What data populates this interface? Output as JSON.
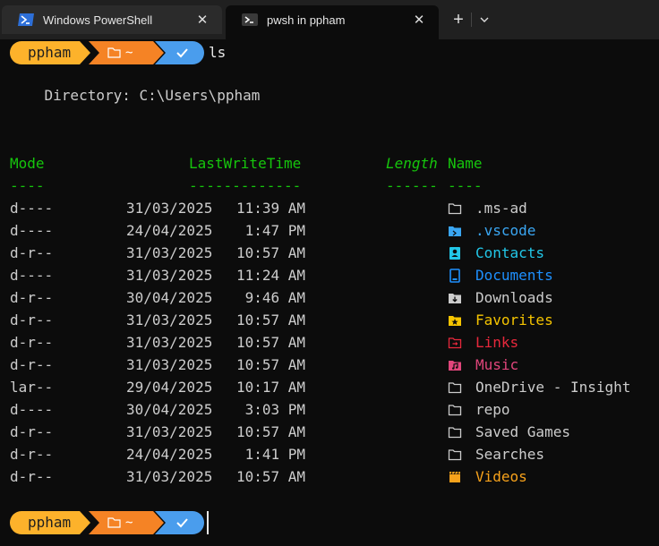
{
  "tabs": [
    {
      "label": "Windows PowerShell",
      "close": "✕"
    },
    {
      "label": "pwsh in ppham",
      "close": "✕"
    }
  ],
  "tabbar": {
    "new_tab": "+",
    "dropdown": "⌄"
  },
  "prompt": {
    "user": "ppham",
    "folder_symbol": "~",
    "command": "ls",
    "colors": {
      "user": "#fdb22b",
      "folder": "#f58325",
      "status": "#4a9ded"
    }
  },
  "directory_line": "    Directory: C:\\Users\\ppham",
  "headers": {
    "mode": "Mode",
    "lastwritetime": "LastWriteTime",
    "length": "Length",
    "name": "Name"
  },
  "underlines": {
    "mode": "----",
    "lastwritetime": "-------------",
    "length": "------",
    "name": "----"
  },
  "rows": [
    {
      "mode": "d----",
      "date": "31/03/2025",
      "time": "11:39 AM",
      "name": ".ms-ad",
      "icon": "folder-icon",
      "color": "#cccccc"
    },
    {
      "mode": "d----",
      "date": "24/04/2025",
      "time": "1:47 PM",
      "name": ".vscode",
      "icon": "vscode-folder-icon",
      "color": "#3aa6f2"
    },
    {
      "mode": "d-r--",
      "date": "31/03/2025",
      "time": "10:57 AM",
      "name": "Contacts",
      "icon": "contacts-icon",
      "color": "#22c7e8"
    },
    {
      "mode": "d----",
      "date": "31/03/2025",
      "time": "11:24 AM",
      "name": "Documents",
      "icon": "documents-icon",
      "color": "#1e90ff"
    },
    {
      "mode": "d-r--",
      "date": "30/04/2025",
      "time": "9:46 AM",
      "name": "Downloads",
      "icon": "downloads-icon",
      "color": "#cccccc"
    },
    {
      "mode": "d-r--",
      "date": "31/03/2025",
      "time": "10:57 AM",
      "name": "Favorites",
      "icon": "favorites-icon",
      "color": "#f5c400"
    },
    {
      "mode": "d-r--",
      "date": "31/03/2025",
      "time": "10:57 AM",
      "name": "Links",
      "icon": "links-icon",
      "color": "#e8283c"
    },
    {
      "mode": "d-r--",
      "date": "31/03/2025",
      "time": "10:57 AM",
      "name": "Music",
      "icon": "music-icon",
      "color": "#e0457b"
    },
    {
      "mode": "lar--",
      "date": "29/04/2025",
      "time": "10:17 AM",
      "name": "OneDrive - Insight",
      "icon": "folder-icon",
      "color": "#cccccc"
    },
    {
      "mode": "d----",
      "date": "30/04/2025",
      "time": "3:03 PM",
      "name": "repo",
      "icon": "folder-icon",
      "color": "#cccccc"
    },
    {
      "mode": "d-r--",
      "date": "31/03/2025",
      "time": "10:57 AM",
      "name": "Saved Games",
      "icon": "folder-icon",
      "color": "#cccccc"
    },
    {
      "mode": "d-r--",
      "date": "24/04/2025",
      "time": "1:41 PM",
      "name": "Searches",
      "icon": "folder-icon",
      "color": "#cccccc"
    },
    {
      "mode": "d-r--",
      "date": "31/03/2025",
      "time": "10:57 AM",
      "name": "Videos",
      "icon": "videos-icon",
      "color": "#f7a21b"
    }
  ]
}
